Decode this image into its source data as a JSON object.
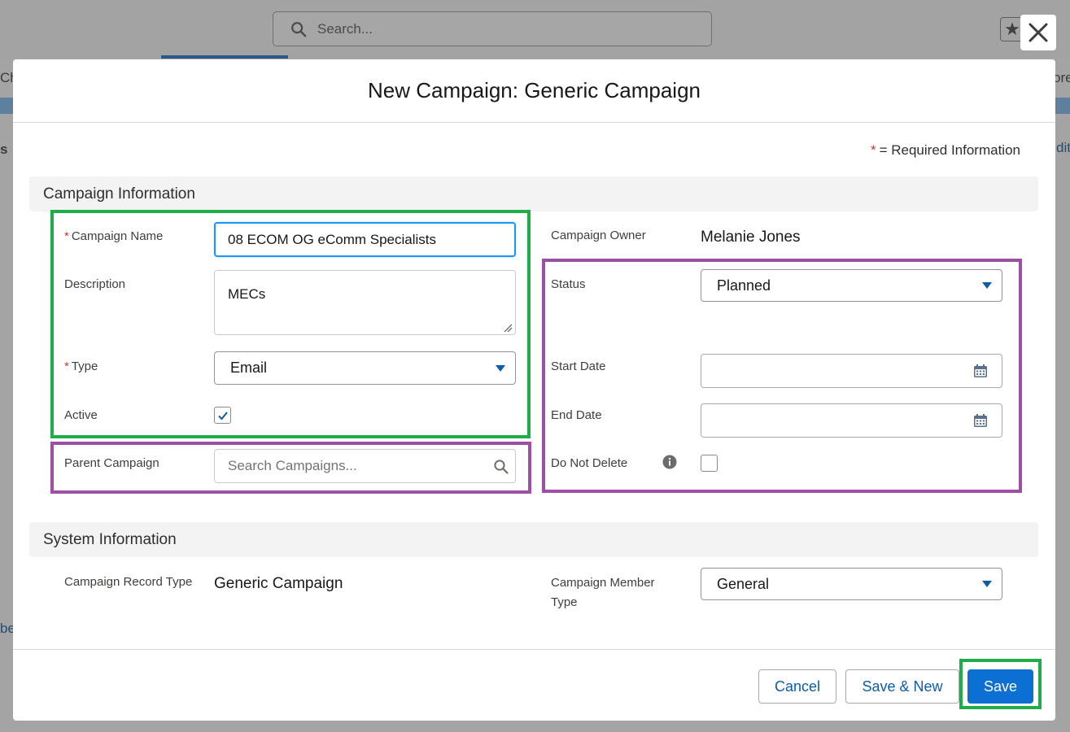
{
  "background": {
    "search_placeholder": "Search...",
    "left_fragment_1": "Ch",
    "right_fragment_1": "ore",
    "left_fragment_2": "s",
    "right_fragment_2": "dit",
    "left_fragment_3": "be"
  },
  "modal": {
    "title": "New Campaign: Generic Campaign",
    "required_info": "= Required Information",
    "required_star": "*"
  },
  "campaign_information": {
    "section_title": "Campaign Information",
    "campaign_name": {
      "label": "Campaign Name",
      "value": "08 ECOM OG eComm Specialists"
    },
    "description": {
      "label": "Description",
      "value": "MECs"
    },
    "type": {
      "label": "Type",
      "value": "Email"
    },
    "active": {
      "label": "Active",
      "checked": true
    },
    "parent_campaign": {
      "label": "Parent Campaign",
      "placeholder": "Search Campaigns..."
    },
    "campaign_owner": {
      "label": "Campaign Owner",
      "value": "Melanie Jones"
    },
    "status": {
      "label": "Status",
      "value": "Planned"
    },
    "start_date": {
      "label": "Start Date",
      "value": ""
    },
    "end_date": {
      "label": "End Date",
      "value": ""
    },
    "do_not_delete": {
      "label": "Do Not Delete",
      "checked": false
    }
  },
  "system_information": {
    "section_title": "System Information",
    "campaign_record_type": {
      "label": "Campaign Record Type",
      "value": "Generic Campaign"
    },
    "campaign_member_type": {
      "label_line1": "Campaign Member",
      "label_line2": "Type",
      "value": "General"
    }
  },
  "footer": {
    "cancel_label": "Cancel",
    "save_new_label": "Save & New",
    "save_label": "Save"
  },
  "colors": {
    "highlight_green": "#1fad4a",
    "highlight_purple": "#9d4fa5",
    "brand_blue": "#0b6fd4",
    "required_red": "#c23934"
  }
}
